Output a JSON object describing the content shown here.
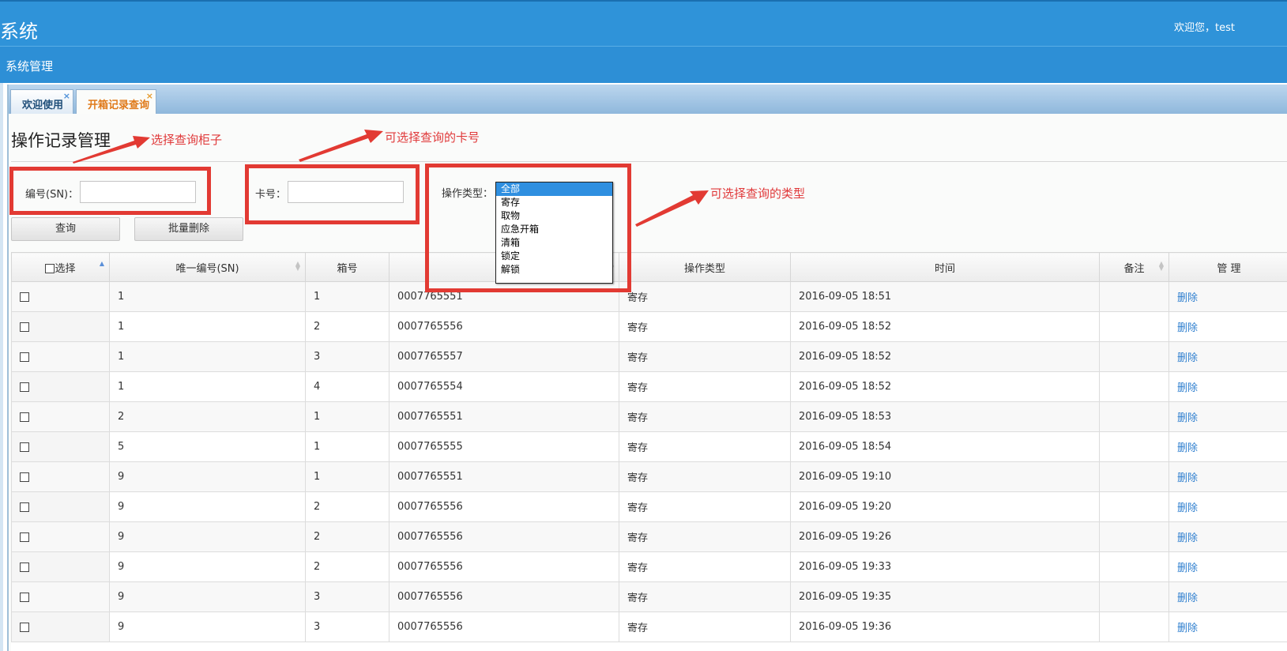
{
  "header": {
    "title": "系统",
    "welcome": "欢迎您，test"
  },
  "menu": {
    "title": "系统管理"
  },
  "tabs": [
    {
      "label": "欢迎使用",
      "close": "×"
    },
    {
      "label": "开箱记录查询",
      "close": "×"
    }
  ],
  "page": {
    "title": "操作记录管理"
  },
  "filters": {
    "sn_label": "编号(SN)：",
    "sn_value": "",
    "card_label": "卡号：",
    "card_value": "",
    "type_label": "操作类型：",
    "type_options": [
      "全部",
      "寄存",
      "取物",
      "应急开箱",
      "清箱",
      "锁定",
      "解锁"
    ],
    "type_selected": "全部"
  },
  "buttons": {
    "query": "查询",
    "batch_delete": "批量删除"
  },
  "annotations": [
    "选择查询柜子",
    "可选择查询的卡号",
    "可选择查询的类型"
  ],
  "table": {
    "columns": [
      "选择",
      "唯一编号(SN)",
      "箱号",
      "",
      "操作类型",
      "时间",
      "备注",
      "管 理"
    ],
    "action_label": "删除",
    "rows": [
      {
        "sn": "1",
        "box": "1",
        "card": "0007765551",
        "type": "寄存",
        "time": "2016-09-05 18:51",
        "note": ""
      },
      {
        "sn": "1",
        "box": "2",
        "card": "0007765556",
        "type": "寄存",
        "time": "2016-09-05 18:52",
        "note": ""
      },
      {
        "sn": "1",
        "box": "3",
        "card": "0007765557",
        "type": "寄存",
        "time": "2016-09-05 18:52",
        "note": ""
      },
      {
        "sn": "1",
        "box": "4",
        "card": "0007765554",
        "type": "寄存",
        "time": "2016-09-05 18:52",
        "note": ""
      },
      {
        "sn": "2",
        "box": "1",
        "card": "0007765551",
        "type": "寄存",
        "time": "2016-09-05 18:53",
        "note": ""
      },
      {
        "sn": "5",
        "box": "1",
        "card": "0007765555",
        "type": "寄存",
        "time": "2016-09-05 18:54",
        "note": ""
      },
      {
        "sn": "9",
        "box": "1",
        "card": "0007765551",
        "type": "寄存",
        "time": "2016-09-05 19:10",
        "note": ""
      },
      {
        "sn": "9",
        "box": "2",
        "card": "0007765556",
        "type": "寄存",
        "time": "2016-09-05 19:20",
        "note": ""
      },
      {
        "sn": "9",
        "box": "2",
        "card": "0007765556",
        "type": "寄存",
        "time": "2016-09-05 19:26",
        "note": ""
      },
      {
        "sn": "9",
        "box": "2",
        "card": "0007765556",
        "type": "寄存",
        "time": "2016-09-05 19:33",
        "note": ""
      },
      {
        "sn": "9",
        "box": "3",
        "card": "0007765556",
        "type": "寄存",
        "time": "2016-09-05 19:35",
        "note": ""
      },
      {
        "sn": "9",
        "box": "3",
        "card": "0007765556",
        "type": "寄存",
        "time": "2016-09-05 19:36",
        "note": ""
      }
    ]
  },
  "colors": {
    "header_blue": "#2f93d9",
    "annotation_red": "#e23a33",
    "link_blue": "#2f7fcf",
    "active_tab_orange": "#e07a1a"
  }
}
